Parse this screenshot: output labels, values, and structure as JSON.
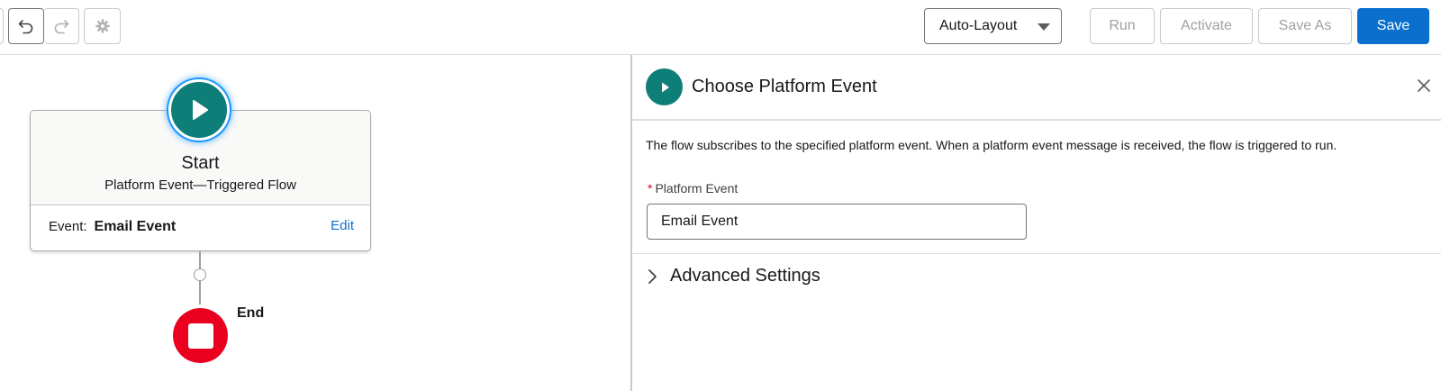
{
  "toolbar": {
    "layout_mode": "Auto-Layout",
    "run_label": "Run",
    "activate_label": "Activate",
    "save_as_label": "Save As",
    "save_label": "Save",
    "icons": [
      "undo-icon",
      "redo-icon",
      "gear-icon",
      "chevron-down-icon"
    ]
  },
  "canvas": {
    "start": {
      "title": "Start",
      "subtitle": "Platform Event—Triggered Flow",
      "event_label": "Event:",
      "event_value": "Email Event",
      "edit_label": "Edit"
    },
    "end": {
      "label": "End"
    }
  },
  "panel": {
    "title": "Choose Platform Event",
    "description": "The flow subscribes to the specified platform event. When a platform event message is received, the flow is triggered to run.",
    "field": {
      "label": "Platform Event",
      "required_marker": "*",
      "value": "Email Event"
    },
    "advanced_label": "Advanced Settings"
  },
  "colors": {
    "brand_blue": "#0b6fce",
    "start_teal": "#0e7e78",
    "end_red": "#ea001e"
  }
}
